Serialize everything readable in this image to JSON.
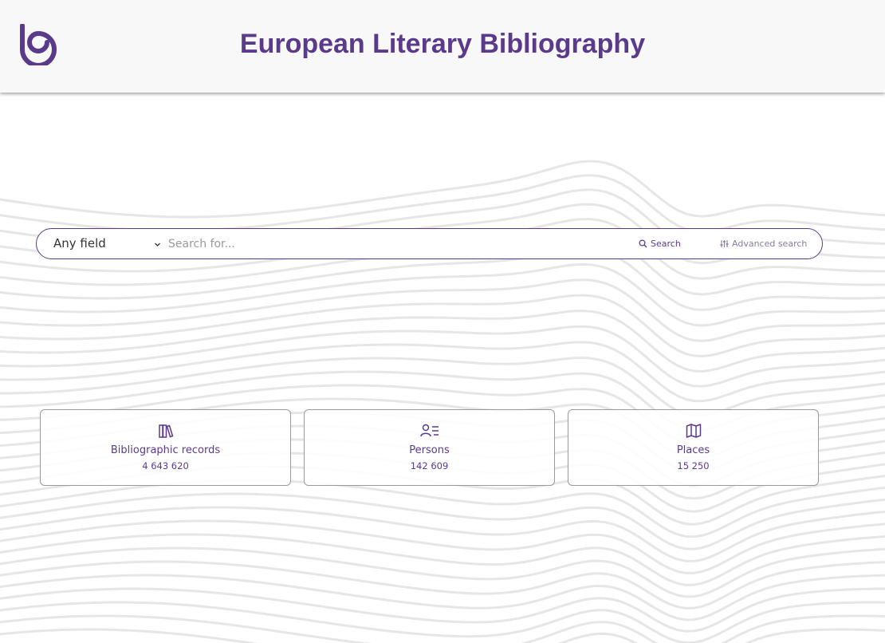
{
  "header": {
    "title": "European Literary Bibliography",
    "logo_icon": "elb-logo-icon"
  },
  "search": {
    "field_selected": "Any field",
    "placeholder": "Search for...",
    "value": "",
    "search_label": "Search",
    "advanced_label": "Advanced search"
  },
  "stats": [
    {
      "icon": "books-icon",
      "label": "Bibliographic records",
      "count": "4 643 620"
    },
    {
      "icon": "person-list-icon",
      "label": "Persons",
      "count": "142 609"
    },
    {
      "icon": "map-icon",
      "label": "Places",
      "count": "15 250"
    }
  ],
  "colors": {
    "accent": "#5b3a8c",
    "header_bg": "#f8f8f8",
    "card_border": "#9a9a9a",
    "wave": "#e6e6e6"
  }
}
